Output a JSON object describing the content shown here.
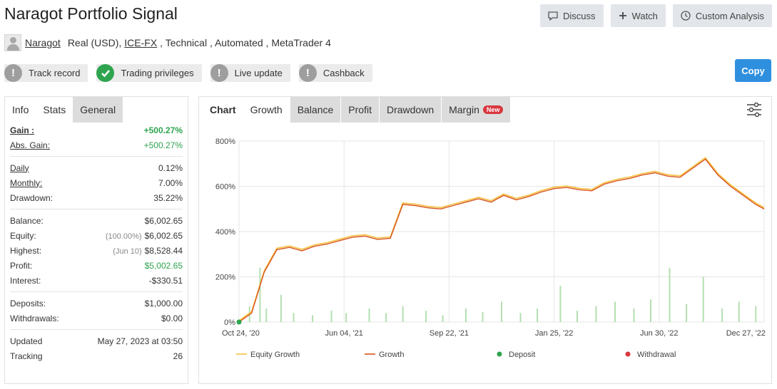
{
  "header": {
    "title": "Naragot Portfolio Signal",
    "discuss_label": "Discuss",
    "watch_label": "Watch",
    "custom_analysis_label": "Custom Analysis"
  },
  "subline": {
    "author": "Naragot",
    "account": "Real (USD),",
    "broker": "ICE-FX",
    "tags": ", Technical , Automated , MetaTrader 4"
  },
  "badges": {
    "track_record": "Track record",
    "trading_privileges": "Trading privileges",
    "live_update": "Live update",
    "cashback": "Cashback"
  },
  "copy_label": "Copy",
  "stats": {
    "tabs": [
      "Info",
      "Stats",
      "General"
    ],
    "gain": {
      "label": "Gain :",
      "value": "+500.27%"
    },
    "abs_gain": {
      "label": "Abs. Gain:",
      "value": "+500.27%"
    },
    "daily": {
      "label": "Daily",
      "value": "0.12%"
    },
    "monthly": {
      "label": "Monthly:",
      "value": "7.00%"
    },
    "drawdown": {
      "label": "Drawdown:",
      "value": "35.22%"
    },
    "balance": {
      "label": "Balance:",
      "value": "$6,002.65"
    },
    "equity": {
      "label": "Equity:",
      "sub": "(100.00%)",
      "value": "$6,002.65"
    },
    "highest": {
      "label": "Highest:",
      "sub": "(Jun 10)",
      "value": "$8,528.44"
    },
    "profit": {
      "label": "Profit:",
      "value": "$5,002.65"
    },
    "interest": {
      "label": "Interest:",
      "value": "-$330.51"
    },
    "deposits": {
      "label": "Deposits:",
      "value": "$1,000.00"
    },
    "withdrawals": {
      "label": "Withdrawals:",
      "value": "$0.00"
    },
    "updated": {
      "label": "Updated",
      "value": "May 27, 2023 at 03:50"
    },
    "tracking": {
      "label": "Tracking",
      "value": "26"
    }
  },
  "chart_tabs": {
    "chart": "Chart",
    "growth": "Growth",
    "balance": "Balance",
    "profit": "Profit",
    "drawdown": "Drawdown",
    "margin": "Margin",
    "new_tag": "New"
  },
  "colors": {
    "equity": "#f5c242",
    "growth": "#d9531e",
    "deposit": "#2ea44f",
    "withdrawal": "#d9363e",
    "bars": "#b3dfb0",
    "copy": "#2f8fdf"
  },
  "chart_data": {
    "type": "line",
    "ylim": [
      0,
      800
    ],
    "yticks": [
      "0%",
      "200%",
      "400%",
      "600%",
      "800%"
    ],
    "ytick_values": [
      0,
      200,
      400,
      600,
      800
    ],
    "xticks": [
      "Oct 24, '20",
      "Jun 04, '21",
      "Sep 22, '21",
      "Jan 25, '22",
      "Jun 30, '22",
      "Dec 27, '22"
    ],
    "legend": [
      "Equity Growth",
      "Growth",
      "Deposit",
      "Withdrawal"
    ],
    "series": [
      {
        "name": "Growth",
        "x": [
          0,
          0.6,
          1.2,
          1.8,
          2.4,
          3.0,
          3.6,
          4.2,
          4.8,
          5.4,
          6.0,
          6.6,
          7.2,
          7.8,
          8.4,
          9.0,
          9.6,
          10.2,
          10.8,
          11.4,
          12.0,
          12.6,
          13.2,
          13.8,
          14.4,
          15.0,
          15.6,
          16.2,
          16.8,
          17.4,
          18.0,
          18.6,
          19.2,
          19.8,
          20.4,
          21.0,
          21.6,
          22.2,
          22.8,
          23.4,
          24.0,
          24.6,
          25.0
        ],
        "values": [
          0,
          40,
          220,
          320,
          330,
          315,
          335,
          345,
          360,
          375,
          380,
          365,
          370,
          520,
          515,
          505,
          500,
          515,
          530,
          545,
          530,
          560,
          540,
          555,
          575,
          590,
          595,
          585,
          580,
          610,
          625,
          635,
          650,
          660,
          645,
          640,
          680,
          720,
          650,
          600,
          560,
          520,
          500
        ]
      }
    ],
    "bars": {
      "name": "Deposit",
      "x": [
        0.5,
        1.0,
        1.3,
        2.0,
        2.6,
        3.5,
        4.4,
        5.1,
        6.2,
        7.0,
        7.8,
        8.9,
        9.7,
        10.8,
        11.6,
        12.5,
        13.4,
        14.2,
        15.3,
        16.1,
        17.0,
        17.9,
        18.8,
        19.6,
        20.5,
        21.3,
        22.1,
        23.0,
        23.8,
        24.6
      ],
      "values": [
        70,
        240,
        60,
        120,
        40,
        30,
        50,
        40,
        60,
        40,
        70,
        50,
        30,
        60,
        45,
        90,
        40,
        60,
        160,
        50,
        70,
        90,
        60,
        100,
        240,
        80,
        200,
        60,
        90,
        70
      ]
    }
  }
}
